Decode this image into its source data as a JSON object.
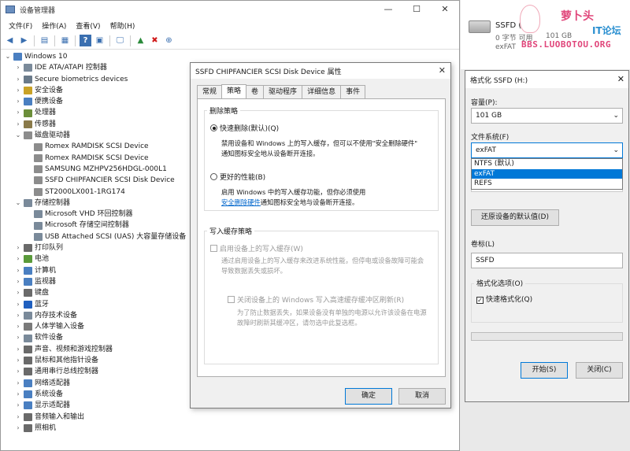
{
  "device_manager": {
    "title": "设备管理器",
    "menu": [
      "文件(F)",
      "操作(A)",
      "查看(V)",
      "帮助(H)"
    ],
    "tree": [
      {
        "level": 0,
        "expanded": true,
        "label": "Windows 10",
        "icon": "computer-icon",
        "color": "#4a7fc1"
      },
      {
        "level": 1,
        "expanded": false,
        "label": "IDE ATA/ATAPI 控制器",
        "icon": "controller-icon",
        "color": "#7a8a9a"
      },
      {
        "level": 1,
        "expanded": false,
        "label": "Secure biometrics devices",
        "icon": "biometric-icon",
        "color": "#6a7a8a"
      },
      {
        "level": 1,
        "expanded": false,
        "label": "安全设备",
        "icon": "security-icon",
        "color": "#c9a227"
      },
      {
        "level": 1,
        "expanded": false,
        "label": "便携设备",
        "icon": "portable-icon",
        "color": "#4a7fc1"
      },
      {
        "level": 1,
        "expanded": false,
        "label": "处理器",
        "icon": "cpu-icon",
        "color": "#6b8e3a"
      },
      {
        "level": 1,
        "expanded": false,
        "label": "传感器",
        "icon": "sensor-icon",
        "color": "#8a7a4a"
      },
      {
        "level": 1,
        "expanded": true,
        "label": "磁盘驱动器",
        "icon": "disk-icon",
        "color": "#8c8c8c"
      },
      {
        "level": 2,
        "expanded": null,
        "label": "Romex RAMDISK SCSI Device",
        "icon": "disk-icon",
        "color": "#8c8c8c"
      },
      {
        "level": 2,
        "expanded": null,
        "label": "Romex RAMDISK SCSI Device",
        "icon": "disk-icon",
        "color": "#8c8c8c"
      },
      {
        "level": 2,
        "expanded": null,
        "label": "SAMSUNG MZHPV256HDGL-000L1",
        "icon": "disk-icon",
        "color": "#8c8c8c"
      },
      {
        "level": 2,
        "expanded": null,
        "label": "SSFD CHIPFANCIER SCSI Disk Device",
        "icon": "disk-icon",
        "color": "#8c8c8c"
      },
      {
        "level": 2,
        "expanded": null,
        "label": "ST2000LX001-1RG174",
        "icon": "disk-icon",
        "color": "#8c8c8c"
      },
      {
        "level": 1,
        "expanded": true,
        "label": "存储控制器",
        "icon": "storage-icon",
        "color": "#7a8a9a"
      },
      {
        "level": 2,
        "expanded": null,
        "label": "Microsoft VHD 环回控制器",
        "icon": "storage-icon",
        "color": "#7a8a9a"
      },
      {
        "level": 2,
        "expanded": null,
        "label": "Microsoft 存储空间控制器",
        "icon": "storage-icon",
        "color": "#7a8a9a"
      },
      {
        "level": 2,
        "expanded": null,
        "label": "USB Attached SCSI (UAS) 大容量存储设备",
        "icon": "storage-icon",
        "color": "#7a8a9a"
      },
      {
        "level": 1,
        "expanded": false,
        "label": "打印队列",
        "icon": "printer-icon",
        "color": "#6a6a6a"
      },
      {
        "level": 1,
        "expanded": false,
        "label": "电池",
        "icon": "battery-icon",
        "color": "#5a9a3a"
      },
      {
        "level": 1,
        "expanded": false,
        "label": "计算机",
        "icon": "computer-icon",
        "color": "#4a7fc1"
      },
      {
        "level": 1,
        "expanded": false,
        "label": "监视器",
        "icon": "monitor-icon",
        "color": "#4a7fc1"
      },
      {
        "level": 1,
        "expanded": false,
        "label": "键盘",
        "icon": "keyboard-icon",
        "color": "#6a6a6a"
      },
      {
        "level": 1,
        "expanded": false,
        "label": "蓝牙",
        "icon": "bluetooth-icon",
        "color": "#1f5fbf"
      },
      {
        "level": 1,
        "expanded": false,
        "label": "内存技术设备",
        "icon": "memory-icon",
        "color": "#7a8a9a"
      },
      {
        "level": 1,
        "expanded": false,
        "label": "人体学输入设备",
        "icon": "hid-icon",
        "color": "#7a7a7a"
      },
      {
        "level": 1,
        "expanded": false,
        "label": "软件设备",
        "icon": "software-icon",
        "color": "#7a8a9a"
      },
      {
        "level": 1,
        "expanded": false,
        "label": "声音、视频和游戏控制器",
        "icon": "speaker-icon",
        "color": "#6a6a6a"
      },
      {
        "level": 1,
        "expanded": false,
        "label": "鼠标和其他指针设备",
        "icon": "mouse-icon",
        "color": "#6a6a6a"
      },
      {
        "level": 1,
        "expanded": false,
        "label": "通用串行总线控制器",
        "icon": "usb-icon",
        "color": "#6a6a6a"
      },
      {
        "level": 1,
        "expanded": false,
        "label": "网络适配器",
        "icon": "network-icon",
        "color": "#4a7fc1"
      },
      {
        "level": 1,
        "expanded": false,
        "label": "系统设备",
        "icon": "system-icon",
        "color": "#4a7fc1"
      },
      {
        "level": 1,
        "expanded": false,
        "label": "显示适配器",
        "icon": "display-adapter-icon",
        "color": "#4a7fc1"
      },
      {
        "level": 1,
        "expanded": false,
        "label": "音频输入和输出",
        "icon": "audio-icon",
        "color": "#6a6a6a"
      },
      {
        "level": 1,
        "expanded": false,
        "label": "照相机",
        "icon": "camera-icon",
        "color": "#6a6a6a"
      }
    ]
  },
  "props": {
    "title": "SSFD CHIPFANCIER SCSI Disk Device 属性",
    "tabs": [
      "常规",
      "策略",
      "卷",
      "驱动程序",
      "详细信息",
      "事件"
    ],
    "removal_policy": {
      "label": "删除策略",
      "quick_label": "快速删除(默认)(Q)",
      "quick_desc1": "禁用设备和 Windows 上的写入缓存，但可以不使用\"安全删除硬件\"",
      "quick_desc2": "通知图标安全地从设备断开连接。",
      "better_label": "更好的性能(B)",
      "better_desc1": "启用 Windows 中的写入缓存功能，但你必须使用",
      "better_link": "安全删除硬件",
      "better_desc2": "通知图标安全地与设备断开连接。"
    },
    "write_cache": {
      "label": "写入缓存策略",
      "enable_label": "启用设备上的写入缓存(W)",
      "enable_desc1": "通过启用设备上的写入缓存来改进系统性能，但停电或设备故障可能会",
      "enable_desc2": "导致数据丢失或损坏。",
      "flush_label": "关闭设备上的 Windows 写入高速缓存缓冲区刷新(R)",
      "flush_desc1": "为了防止数据丢失，如果设备没有单独的电源以允许该设备在电源",
      "flush_desc2": "故障时刷新其缓冲区，请勿选中此复选框。"
    },
    "ok": "确定",
    "cancel": "取消"
  },
  "ssfd_window": {
    "name": "SSFD (H:)",
    "free": "0 字节 可用",
    "total": "101 GB",
    "fs": "exFAT"
  },
  "watermark": {
    "brand": "萝卜头",
    "site": "IT论坛",
    "url": "BBS.LUOBOTOU.ORG"
  },
  "format": {
    "title": "格式化 SSFD (H:)",
    "capacity_label": "容量(P):",
    "capacity_value": "101 GB",
    "fs_label": "文件系统(F)",
    "fs_value": "exFAT",
    "fs_options": [
      "NTFS (默认)",
      "exFAT",
      "REFS"
    ],
    "fs_selected_index": 1,
    "restore_button": "还原设备的默认值(D)",
    "volume_label": "卷标(L)",
    "volume_value": "SSFD",
    "options_label": "格式化选项(O)",
    "quick_format": "快速格式化(Q)",
    "start": "开始(S)",
    "close": "关闭(C)"
  }
}
